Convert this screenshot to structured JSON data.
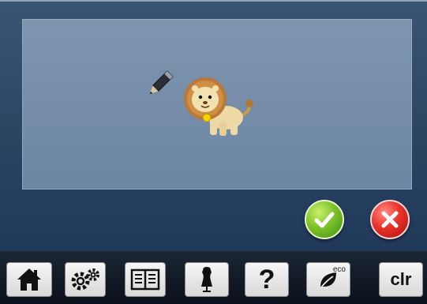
{
  "dialog": {
    "confirm_icon": "checkmark-icon",
    "cancel_icon": "cross-icon",
    "colors": {
      "confirm": "#5fb51e",
      "cancel": "#d92b22"
    }
  },
  "canvas": {
    "tool_icon": "pencil-icon",
    "motif_icon": "lion-embroidery-design"
  },
  "toolbar": {
    "buttons": [
      {
        "icon": "home-icon"
      },
      {
        "icon": "settings-gears-icon"
      },
      {
        "icon": "book-tutorial-icon"
      },
      {
        "icon": "dress-form-icon"
      },
      {
        "icon": "help-icon",
        "label": "?"
      },
      {
        "icon": "eco-leaf-icon",
        "label": "eco"
      },
      {
        "icon": "clear-icon",
        "label": "clr"
      }
    ]
  }
}
